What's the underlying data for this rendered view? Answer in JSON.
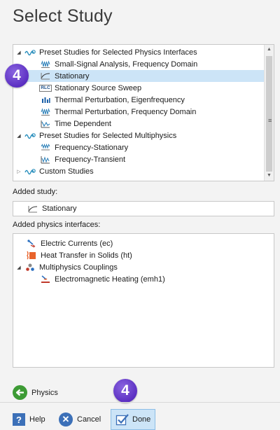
{
  "title": "Select Study",
  "tree": {
    "items": [
      {
        "label": "Preset Studies for Selected Physics Interfaces",
        "icon": "preset-studies-icon"
      },
      {
        "label": "Small-Signal Analysis, Frequency Domain",
        "icon": "frequency-domain-icon"
      },
      {
        "label": "Stationary",
        "icon": "stationary-icon",
        "selected": true
      },
      {
        "label": "Stationary Source Sweep",
        "icon": "rlc-icon",
        "icon_text": "RLC"
      },
      {
        "label": "Thermal Perturbation, Eigenfrequency",
        "icon": "eigenfrequency-icon"
      },
      {
        "label": "Thermal Perturbation, Frequency Domain",
        "icon": "frequency-domain-icon"
      },
      {
        "label": "Time Dependent",
        "icon": "time-dependent-icon"
      },
      {
        "label": "Preset Studies for Selected Multiphysics",
        "icon": "preset-studies-icon"
      },
      {
        "label": "Frequency-Stationary",
        "icon": "frequency-stationary-icon"
      },
      {
        "label": "Frequency-Transient",
        "icon": "frequency-transient-icon"
      },
      {
        "label": "Custom Studies",
        "icon": "preset-studies-icon"
      }
    ]
  },
  "added_study": {
    "label": "Added study:",
    "value": "Stationary"
  },
  "physics": {
    "label": "Added physics interfaces:",
    "items": [
      {
        "label": "Electric Currents (ec)",
        "icon": "electric-currents-icon"
      },
      {
        "label": "Heat Transfer in Solids (ht)",
        "icon": "heat-transfer-icon"
      },
      {
        "label": "Multiphysics Couplings",
        "icon": "multiphysics-icon"
      },
      {
        "label": "Electromagnetic Heating (emh1)",
        "icon": "electromagnetic-heating-icon"
      }
    ]
  },
  "badges": {
    "step": "4"
  },
  "buttons": {
    "physics": "Physics",
    "help": "Help",
    "help_glyph": "?",
    "cancel": "Cancel",
    "cancel_glyph": "✕",
    "done": "Done"
  },
  "colors": {
    "selection": "#cce4f7",
    "badge": "#5b2fc2",
    "physics_green": "#3d9b35",
    "button_blue": "#3c70b8"
  }
}
